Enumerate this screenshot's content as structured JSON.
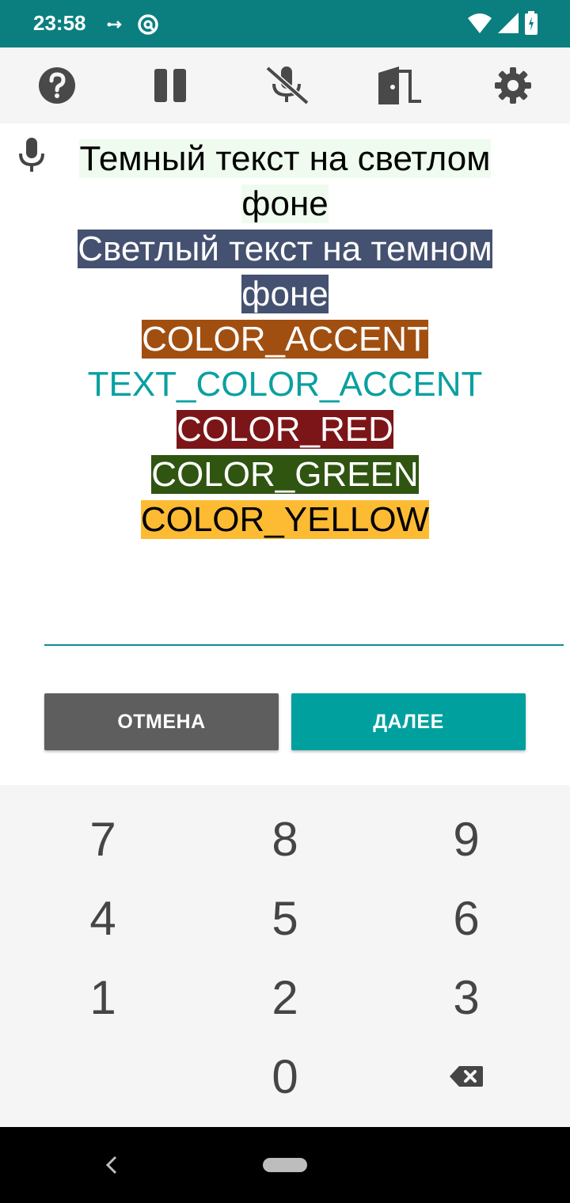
{
  "status_bar": {
    "time": "23:58",
    "left_icons": [
      "usb-icon",
      "at-sign-icon"
    ],
    "right_icons": [
      "wifi-icon",
      "signal-icon",
      "battery-icon"
    ],
    "background": "#0b7f80"
  },
  "toolbar": {
    "items": [
      {
        "name": "help",
        "icon": "help-circle-icon"
      },
      {
        "name": "pause",
        "icon": "pause-icon"
      },
      {
        "name": "mic-off",
        "icon": "mic-off-icon"
      },
      {
        "name": "exit",
        "icon": "exit-door-icon"
      },
      {
        "name": "settings",
        "icon": "gear-icon"
      }
    ]
  },
  "content": {
    "lines": [
      {
        "text": "Темный текст на светлом фоне",
        "style": "dark-on-light"
      },
      {
        "text": "Светлый текст на темном фоне",
        "style": "light-on-dark"
      },
      {
        "text": "COLOR_ACCENT",
        "style": "accent"
      },
      {
        "text": "TEXT_COLOR_ACCENT",
        "style": "text-accent"
      },
      {
        "text": "COLOR_RED",
        "style": "red"
      },
      {
        "text": "COLOR_GREEN",
        "style": "green"
      },
      {
        "text": "COLOR_YELLOW",
        "style": "yellow"
      }
    ],
    "colors": {
      "accent": "#a14f11",
      "text_accent": "#0aa0a0",
      "red": "#7c1518",
      "green": "#2f5511",
      "yellow": "#fdbb34",
      "dark_bg": "#455170",
      "light_bg": "#effbee"
    }
  },
  "input": {
    "value": ""
  },
  "buttons": {
    "cancel_label": "ОТМЕНА",
    "next_label": "ДАЛЕЕ"
  },
  "keypad": {
    "keys": [
      "7",
      "8",
      "9",
      "4",
      "5",
      "6",
      "1",
      "2",
      "3",
      "0"
    ],
    "backspace_icon": "backspace-icon"
  },
  "nav_bar": {
    "back_icon": "back-chevron-icon",
    "home_icon": "home-pill-icon"
  }
}
